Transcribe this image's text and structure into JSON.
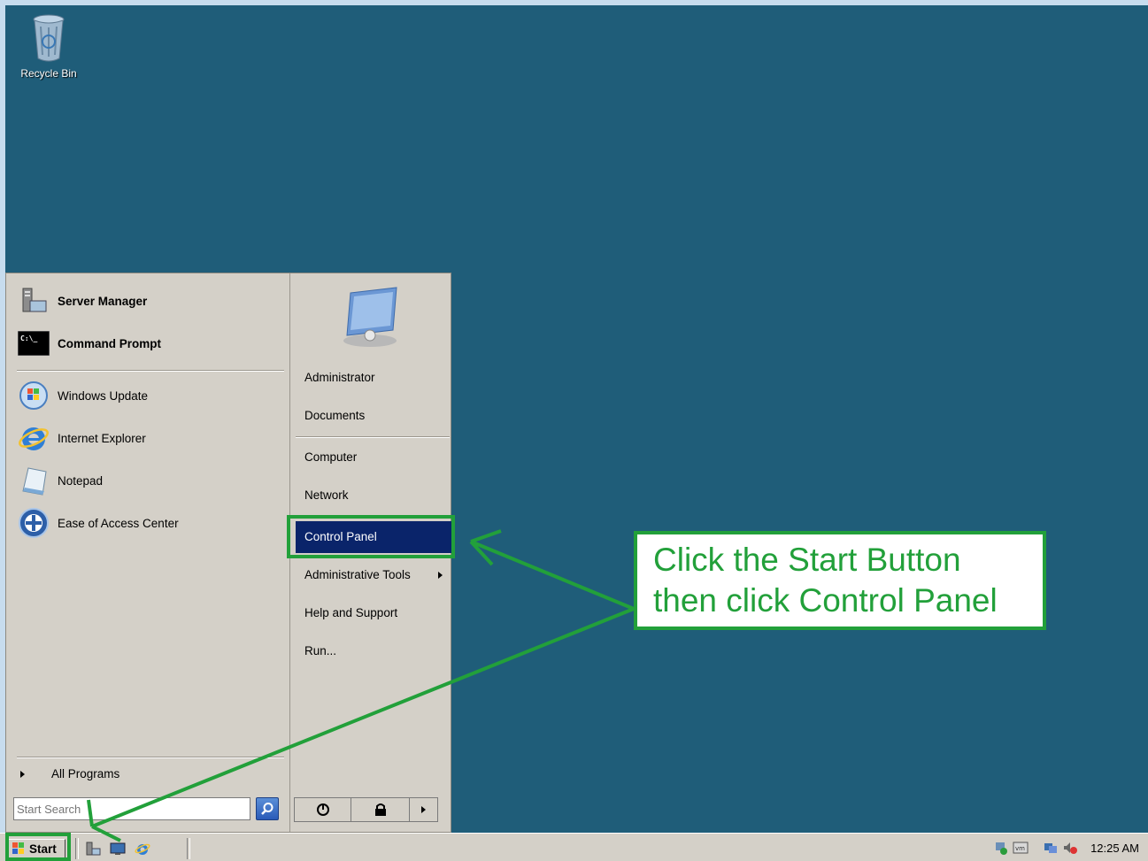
{
  "desktop": {
    "recycle_bin_label": "Recycle Bin"
  },
  "start_menu": {
    "pinned": [
      {
        "label": "Server Manager",
        "icon": "server-manager-icon"
      },
      {
        "label": "Command Prompt",
        "icon": "command-prompt-icon"
      }
    ],
    "recent": [
      {
        "label": "Windows Update",
        "icon": "windows-update-icon"
      },
      {
        "label": "Internet Explorer",
        "icon": "internet-explorer-icon"
      },
      {
        "label": "Notepad",
        "icon": "notepad-icon"
      },
      {
        "label": "Ease of Access Center",
        "icon": "ease-of-access-icon"
      }
    ],
    "all_programs": "All Programs",
    "search_placeholder": "Start Search",
    "right": {
      "administrator": "Administrator",
      "documents": "Documents",
      "computer": "Computer",
      "network": "Network",
      "control_panel": "Control Panel",
      "administrative_tools": "Administrative Tools",
      "help_and_support": "Help and Support",
      "run": "Run..."
    },
    "selected_item": "Control Panel"
  },
  "taskbar": {
    "start_label": "Start",
    "clock": "12:25 AM"
  },
  "annotation": {
    "line1": "Click the Start Button",
    "line2": "then click Control Panel",
    "color": "#22a03a"
  },
  "colors": {
    "desktop": "#1f5d79",
    "menu": "#d4d0c8",
    "selection": "#0a246a"
  }
}
